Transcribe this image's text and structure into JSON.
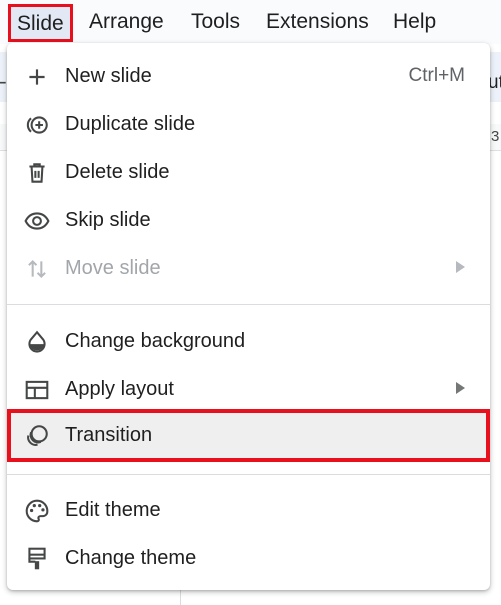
{
  "menubar": {
    "items": [
      "Slide",
      "Arrange",
      "Tools",
      "Extensions",
      "Help"
    ]
  },
  "background": {
    "toolbar_fragment": "ut",
    "ruler_fragment": "3"
  },
  "menu": {
    "items": [
      {
        "label": "New slide",
        "icon": "plus-icon",
        "shortcut": "Ctrl+M"
      },
      {
        "label": "Duplicate slide",
        "icon": "duplicate-slide-icon"
      },
      {
        "label": "Delete slide",
        "icon": "trash-icon"
      },
      {
        "label": "Skip slide",
        "icon": "eye-icon"
      },
      {
        "label": "Move slide",
        "icon": "move-arrows-icon",
        "disabled": true,
        "submenu": true
      },
      {
        "label": "Change background",
        "icon": "paint-drop-icon"
      },
      {
        "label": "Apply layout",
        "icon": "layout-icon",
        "submenu": true
      },
      {
        "label": "Transition",
        "icon": "transition-icon",
        "selected": true
      },
      {
        "label": "Edit theme",
        "icon": "palette-icon"
      },
      {
        "label": "Change theme",
        "icon": "paint-brush-icon"
      }
    ]
  },
  "colors": {
    "highlight_border": "#e8101c",
    "menu_text": "#1f1f1f",
    "disabled_text": "#a2a6ab"
  }
}
